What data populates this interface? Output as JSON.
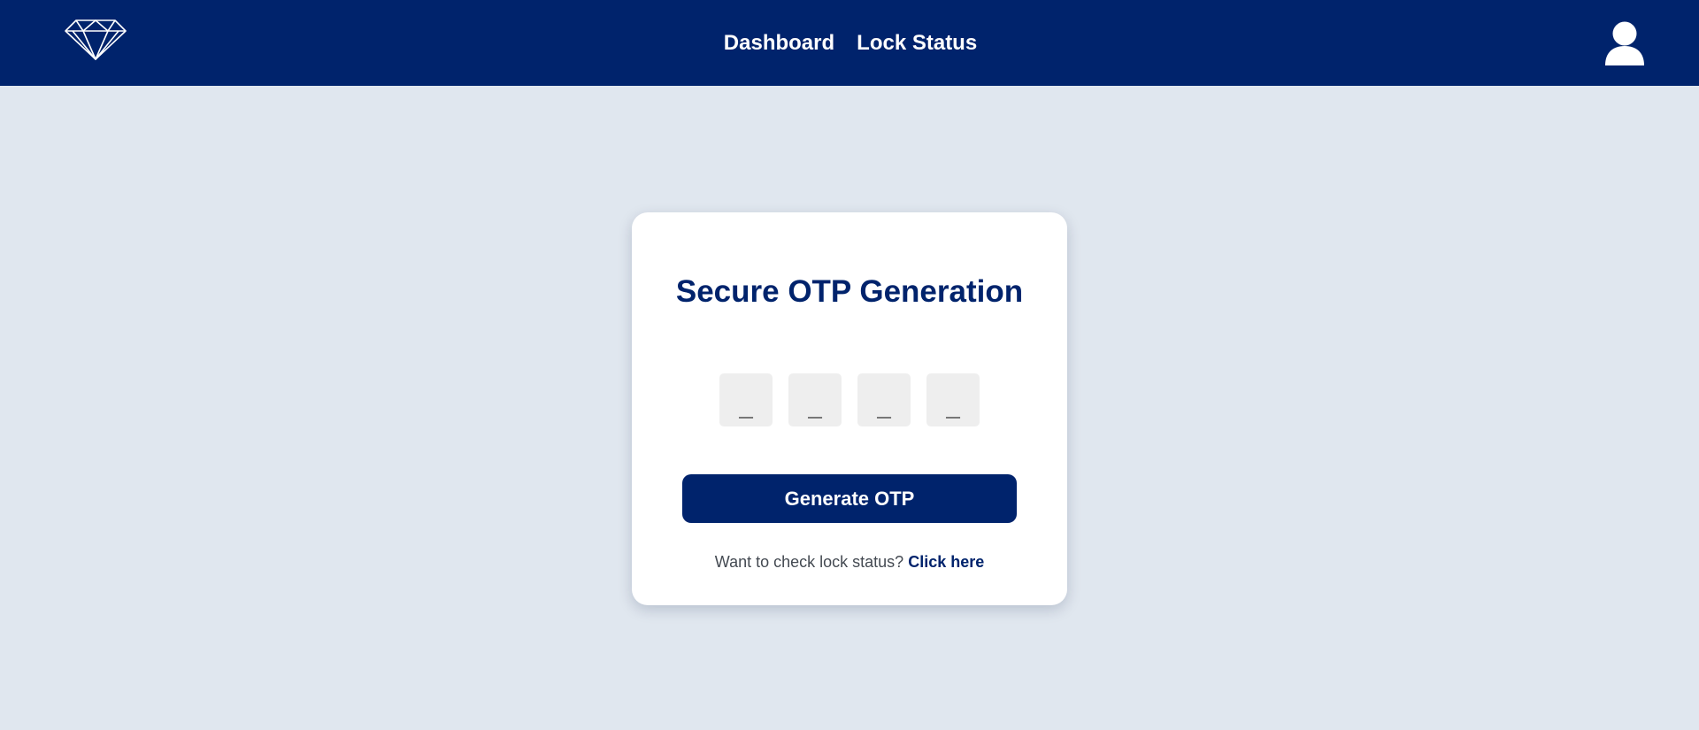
{
  "nav": {
    "logo_icon": "diamond-icon",
    "links": [
      {
        "label": "Dashboard"
      },
      {
        "label": "Lock Status"
      }
    ],
    "profile_icon": "user-icon",
    "background_color": "#00236c"
  },
  "card": {
    "title": "Secure OTP Generation",
    "otp_digits": [
      "_",
      "_",
      "_",
      "_"
    ],
    "generate_button_label": "Generate OTP",
    "prompt_text": "Want to check lock status?",
    "link_text": "Click here"
  },
  "colors": {
    "page_background": "#e0e7ef",
    "accent": "#00236c",
    "card_background": "#ffffff",
    "otp_box_background": "#eeeeee"
  }
}
